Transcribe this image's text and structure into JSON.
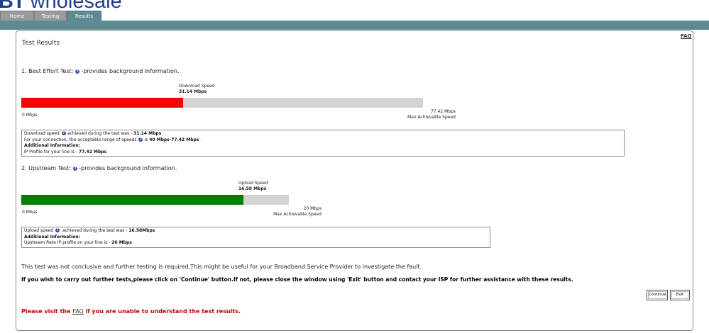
{
  "header": {
    "logo_bold": "BT",
    "logo_text": "wholesale",
    "tabs": [
      {
        "label": "Home"
      },
      {
        "label": "Testing"
      },
      {
        "label": "Results"
      }
    ],
    "accent_color": "#5e8a93"
  },
  "faq_link": "FAQ",
  "page_title": "Test Results",
  "best_effort": {
    "heading_prefix": "1. Best Effort Test:",
    "heading_suffix": "-provides background information.",
    "bar_caption": "Download Speed",
    "bar_value": "31.14 Mbps",
    "min_label": "0 Mbps",
    "max_value": "77.42 Mbps",
    "max_caption": "Max Achievable Speed",
    "fill_fraction": 0.402,
    "fill_color": "#ff0000",
    "info": {
      "line1_prefix": "Download speed",
      "line1_middle": "achieved during the test was - ",
      "line1_value": "31.14 Mbps",
      "line2_prefix": "For your connection, the acceptable range of speeds",
      "line2_middle": "is ",
      "line2_value": "40 Mbps-77.42 Mbps",
      "line2_suffix": " .",
      "line3": "Additional Information:",
      "line4_prefix": "IP Profile for your line is - ",
      "line4_value": "77.42 Mbps"
    }
  },
  "upstream": {
    "heading_prefix": "2. Upstream Test:",
    "heading_suffix": "-provides background information.",
    "bar_caption": "Upload Speed",
    "bar_value": "16.58 Mbps",
    "min_label": "0 Mbps",
    "max_value": "20 Mbps",
    "max_caption": "Max Achievable Speed",
    "fill_fraction": 0.829,
    "fill_color": "#008000",
    "info": {
      "line1_prefix": "Upload speed",
      "line1_middle": " achieved during the test was - ",
      "line1_value": "16.58Mbps",
      "line2": "Additional Information:",
      "line3_prefix": "Upstream Rate IP profile on your line is - ",
      "line3_value": "20 Mbps"
    }
  },
  "message_inconclusive": "This test was not conclusive and further testing is required.This might be useful for your Broadband Service Provider to investigate the fault.",
  "message_instructions": "If you wish to carry out further tests,please click on 'Continue' button.If not, please close the window using 'Exit' button and contact your ISP for further assistance with these results.",
  "message_faq": {
    "prefix": "Please visit the ",
    "link": "FAQ",
    "suffix": " if you are unable to understand the test results."
  },
  "buttons": {
    "continue": "Continue",
    "exit": "Exit"
  }
}
